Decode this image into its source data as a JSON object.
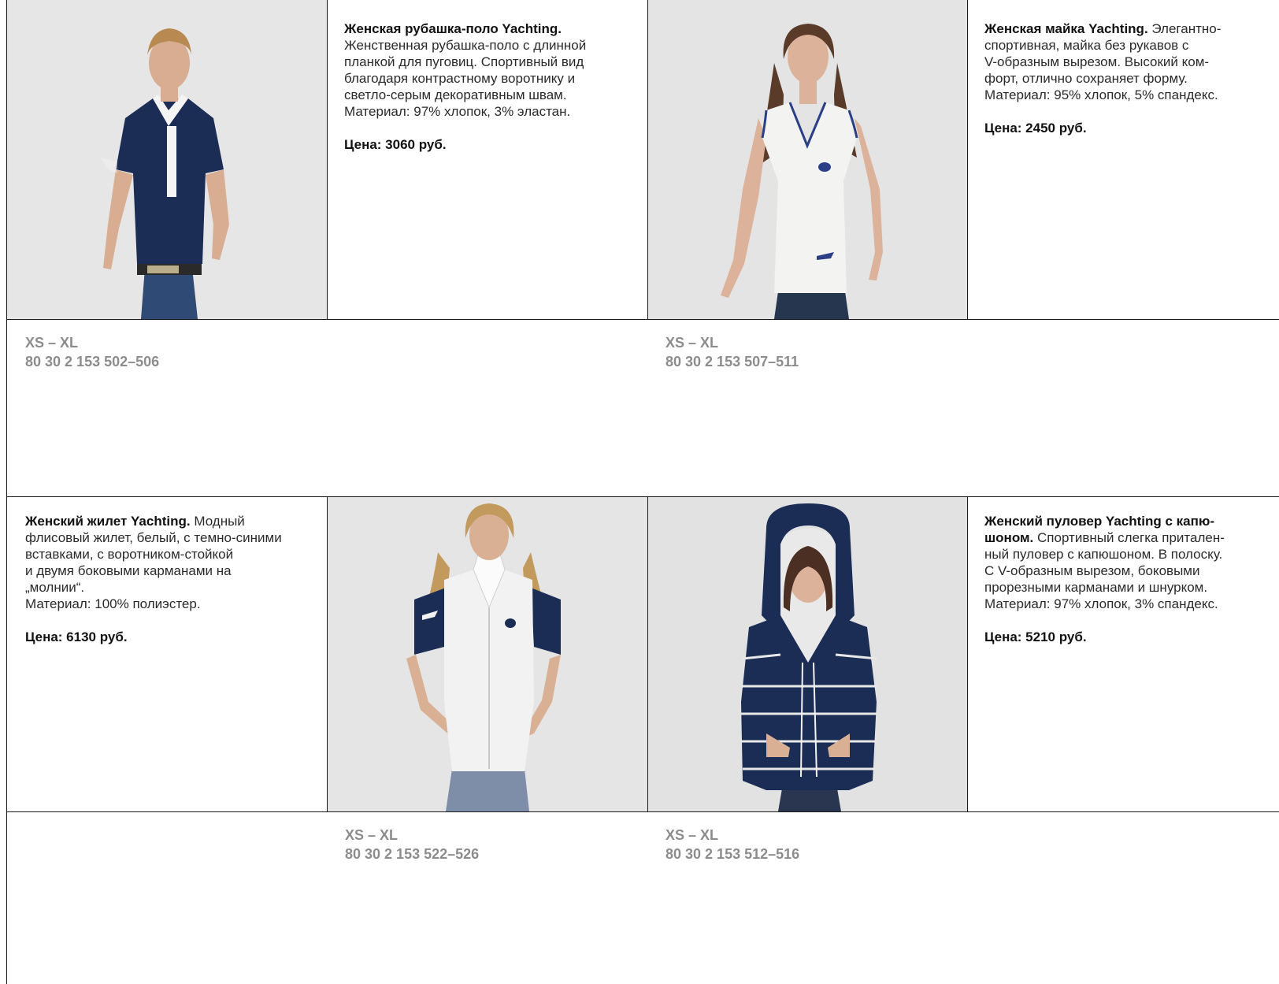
{
  "products": [
    {
      "title": "Женская рубашка-поло Yachting.",
      "lines": [
        "Женственная рубашка-поло с длинной",
        "планкой для пуговиц. Спортивный вид",
        "благодаря контрастному воротнику и",
        "светло-серым декоративным швам.",
        "Материал: 97% хлопок, 3% эластан."
      ],
      "price": "Цена: 3060 руб.",
      "sizes": "XS – XL",
      "article": "80 30 2 153 502–506",
      "colors": {
        "top": "#1b2d55",
        "collar": "#f4f4f4",
        "hair": "#b88a52"
      }
    },
    {
      "title": "Женская майка Yachting.",
      "title_tail": "Элегантно-",
      "lines": [
        "спортивная, майка без рукавов с",
        "V-образным вырезом. Высокий ком-",
        "форт, отлично сохраняет форму.",
        "Материал: 95% хлопок, 5% спандекс."
      ],
      "price": "Цена: 2450 руб.",
      "sizes": "XS – XL",
      "article": "80 30 2 153 507–511",
      "colors": {
        "top": "#f3f3f1",
        "trim": "#2b3f86",
        "hair": "#5a3a28"
      }
    },
    {
      "title": "Женский жилет Yachting.",
      "title_tail": "Модный",
      "lines": [
        "флисовый жилет, белый, с темно-синими",
        "вставками, с воротником-стойкой",
        "и двумя боковыми карманами на",
        "„молнии“.",
        "Материал: 100% полиэстер."
      ],
      "price": "Цена: 6130 руб.",
      "sizes": "XS – XL",
      "article": "80 30 2 153 522–526",
      "colors": {
        "top": "#f2f2f2",
        "sleeve": "#1b2d55",
        "hair": "#c29a5e"
      }
    },
    {
      "title": "Женский пуловер Yachting с капю-",
      "title2": "шоном.",
      "title_tail": "Спортивный слегка притален-",
      "lines": [
        "ный пуловер с капюшоном. В полоску.",
        "С V-образным вырезом, боковыми",
        "прорезными карманами и шнурком.",
        "Материал: 97% хлопок, 3% спандекс."
      ],
      "price": "Цена: 5210 руб.",
      "sizes": "XS – XL",
      "article": "80 30 2 153 512–516",
      "colors": {
        "top": "#1b2d55",
        "stripe": "#e8e8e8",
        "hair": "#4a2f22"
      }
    }
  ]
}
